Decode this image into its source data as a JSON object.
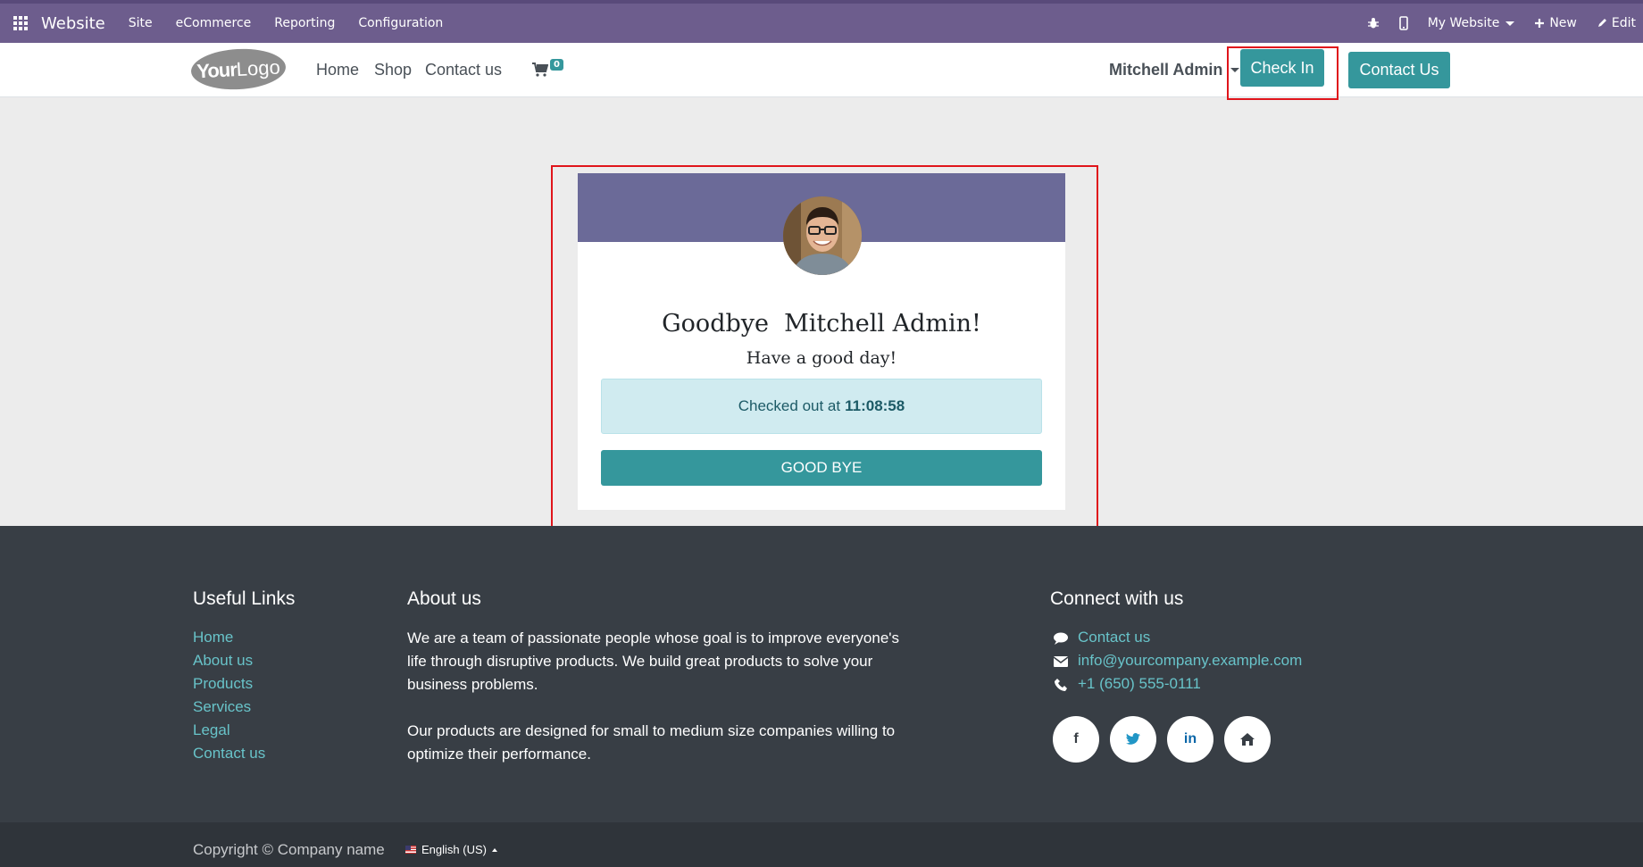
{
  "admin_bar": {
    "brand": "Website",
    "menus": [
      "Site",
      "eCommerce",
      "Reporting",
      "Configuration"
    ],
    "website_switcher": "My Website",
    "new_label": "New",
    "edit_label": "Edit"
  },
  "header": {
    "logo_text_bold": "Your",
    "logo_text_light": "Logo",
    "nav": [
      "Home",
      "Shop",
      "Contact us"
    ],
    "cart_count": "0",
    "user_name": "Mitchell Admin",
    "check_in_label": "Check In",
    "contact_button": "Contact Us"
  },
  "card": {
    "greeting": "Goodbye  Mitchell Admin!",
    "subtitle": "Have a good day!",
    "status_prefix": "Checked out at",
    "status_time": "11:08:58",
    "goodbye_button": "GOOD BYE"
  },
  "footer": {
    "useful_links": {
      "title": "Useful Links",
      "items": [
        "Home",
        "About us",
        "Products",
        "Services",
        "Legal",
        "Contact us"
      ]
    },
    "about": {
      "title": "About us",
      "lines": [
        "We are a team of passionate people whose goal is to improve everyone's",
        "life through disruptive products. We build great products to solve your",
        "business problems.",
        "Our products are designed for small to medium size companies willing to",
        "optimize their performance."
      ]
    },
    "connect": {
      "title": "Connect with us",
      "contact_link": "Contact us",
      "email": "info@yourcompany.example.com",
      "phone": "+1 (650) 555-0111",
      "social": [
        "f",
        "t",
        "in",
        "home"
      ]
    }
  },
  "copyright": {
    "text": "Copyright © Company name",
    "language": "English (US)"
  },
  "colors": {
    "admin_bar": "#6d5d8d",
    "teal": "#35979c",
    "link": "#68c3c9",
    "footer": "#383e45",
    "highlight": "#e0151b"
  }
}
